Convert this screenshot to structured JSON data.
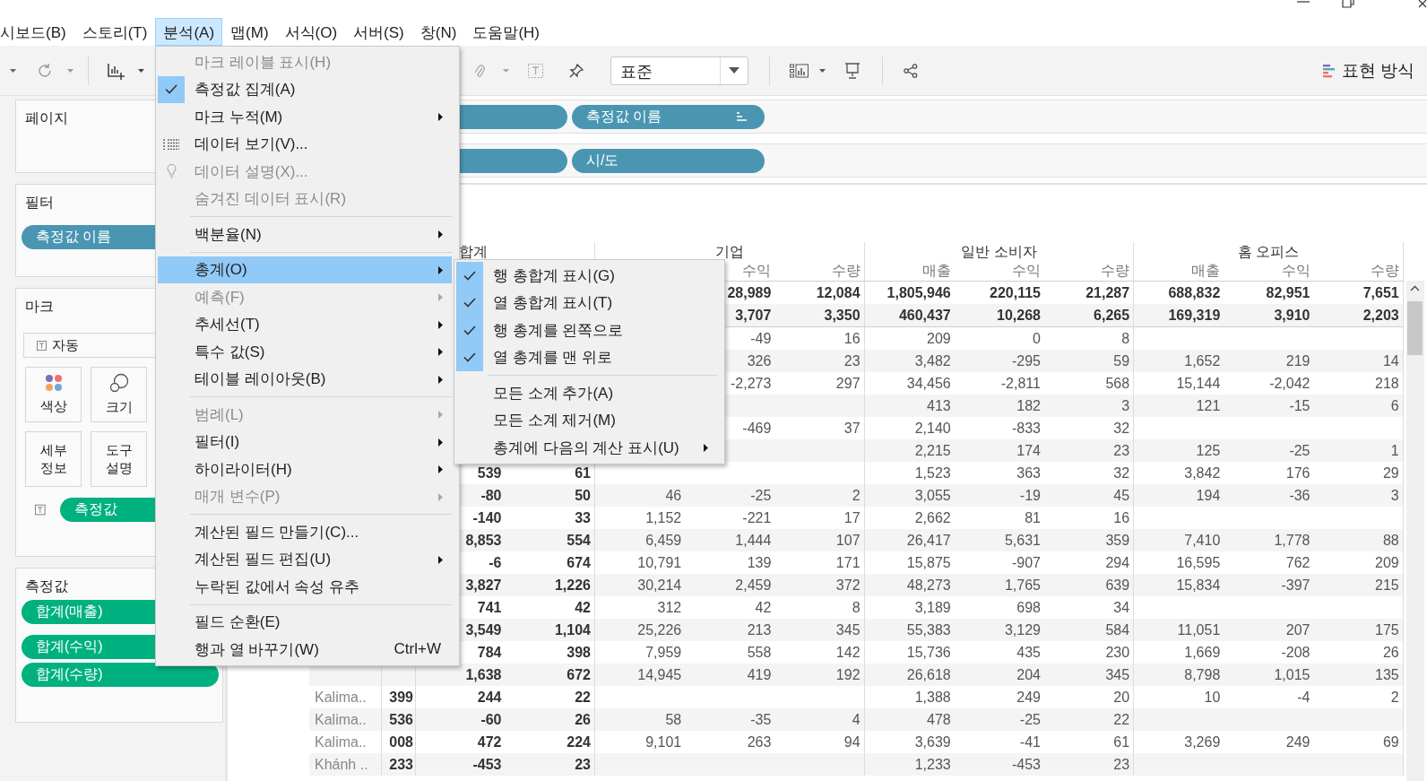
{
  "menu_bar": [
    {
      "label": "시보드(B)",
      "selected": false
    },
    {
      "label": "스토리(T)",
      "selected": false
    },
    {
      "label": "분석(A)",
      "selected": true
    },
    {
      "label": "맵(M)",
      "selected": false
    },
    {
      "label": "서식(O)",
      "selected": false
    },
    {
      "label": "서버(S)",
      "selected": false
    },
    {
      "label": "창(N)",
      "selected": false
    },
    {
      "label": "도움말(H)",
      "selected": false
    }
  ],
  "toolbar": {
    "mark_type": "표준",
    "show_me": "표현 방식"
  },
  "side_panel": {
    "pages": {
      "title": "페이지"
    },
    "filters": {
      "title": "필터",
      "pills": [
        "측정값 이름"
      ]
    },
    "marks": {
      "title": "마크",
      "mark_type": "자동",
      "buttons": [
        {
          "label": "색상",
          "kind": "color"
        },
        {
          "label": "크기",
          "kind": "size"
        },
        {
          "label": "세부 정보",
          "kind": "detail"
        },
        {
          "label": "도구 설명",
          "kind": "tooltip"
        }
      ],
      "text_pills": [
        "측정값"
      ]
    },
    "measures": {
      "title": "측정값",
      "pills": [
        "합계(매출)",
        "합계(수익)",
        "합계(수량)"
      ]
    }
  },
  "shelves": [
    {
      "pill": "측정값 이름",
      "sorted": true
    },
    {
      "pill": "시/도",
      "sorted": false
    }
  ],
  "table": {
    "groups": [
      {
        "label": "합계",
        "kind": "total",
        "columns": [
          null,
          null
        ]
      },
      {
        "label": "기업",
        "kind": "segment",
        "columns": [
          null,
          "수익",
          "수량"
        ]
      },
      {
        "label": "일반 소비자",
        "kind": "segment",
        "columns": [
          "매출",
          "수익",
          "수량"
        ]
      },
      {
        "label": "홈 오피스",
        "kind": "segment",
        "columns": [
          "매출",
          "수익",
          "수량"
        ]
      }
    ],
    "rows": [
      {
        "kind": "total",
        "header": null,
        "code": null,
        "cells": [
          null,
          null,
          null,
          "28,989",
          "12,084",
          "1,805,946",
          "220,115",
          "21,287",
          "688,832",
          "82,951",
          "7,651"
        ]
      },
      {
        "kind": "total",
        "header": null,
        "code": null,
        "cells": [
          null,
          null,
          null,
          "3,707",
          "3,350",
          "460,437",
          "10,268",
          "6,265",
          "169,319",
          "3,910",
          "2,203"
        ]
      },
      {
        "kind": "data",
        "header": null,
        "code": null,
        "cells": [
          null,
          null,
          null,
          "-49",
          "16",
          "209",
          "0",
          "8",
          null,
          null,
          null
        ]
      },
      {
        "kind": "data",
        "header": null,
        "code": null,
        "cells": [
          null,
          null,
          null,
          "326",
          "23",
          "3,482",
          "-295",
          "59",
          "1,652",
          "219",
          "14"
        ]
      },
      {
        "kind": "data",
        "header": null,
        "code": null,
        "cells": [
          null,
          null,
          null,
          "-2,273",
          "297",
          "34,456",
          "-2,811",
          "568",
          "15,144",
          "-2,042",
          "218"
        ]
      },
      {
        "kind": "data",
        "header": null,
        "code": null,
        "cells": [
          null,
          null,
          null,
          null,
          null,
          "413",
          "182",
          "3",
          "121",
          "-15",
          "6"
        ]
      },
      {
        "kind": "data",
        "header": null,
        "code": null,
        "cells": [
          null,
          null,
          null,
          "-469",
          "37",
          "2,140",
          "-833",
          "32",
          null,
          null,
          null
        ]
      },
      {
        "kind": "data",
        "header": null,
        "code": null,
        "cells": [
          null,
          null,
          null,
          null,
          null,
          "2,215",
          "174",
          "23",
          "125",
          "-25",
          "1"
        ]
      },
      {
        "kind": "data",
        "header": null,
        "code": null,
        "cells": [
          "539",
          "61",
          null,
          null,
          null,
          "1,523",
          "363",
          "32",
          "3,842",
          "176",
          "29"
        ]
      },
      {
        "kind": "data",
        "header": null,
        "code": null,
        "cells": [
          "-80",
          "50",
          "46",
          "-25",
          "2",
          "3,055",
          "-19",
          "45",
          "194",
          "-36",
          "3"
        ]
      },
      {
        "kind": "data",
        "header": null,
        "code": null,
        "cells": [
          "-140",
          "33",
          "1,152",
          "-221",
          "17",
          "2,662",
          "81",
          "16",
          null,
          null,
          null
        ]
      },
      {
        "kind": "data",
        "header": null,
        "code": null,
        "cells": [
          "8,853",
          "554",
          "6,459",
          "1,444",
          "107",
          "26,417",
          "5,631",
          "359",
          "7,410",
          "1,778",
          "88"
        ]
      },
      {
        "kind": "data",
        "header": null,
        "code": null,
        "cells": [
          "-6",
          "674",
          "10,791",
          "139",
          "171",
          "15,875",
          "-907",
          "294",
          "16,595",
          "762",
          "209"
        ]
      },
      {
        "kind": "data",
        "header": null,
        "code": null,
        "cells": [
          "3,827",
          "1,226",
          "30,214",
          "2,459",
          "372",
          "48,273",
          "1,765",
          "639",
          "15,834",
          "-397",
          "215"
        ]
      },
      {
        "kind": "data",
        "header": null,
        "code": null,
        "cells": [
          "741",
          "42",
          "312",
          "42",
          "8",
          "3,189",
          "698",
          "34",
          null,
          null,
          null
        ]
      },
      {
        "kind": "data",
        "header": null,
        "code": null,
        "cells": [
          "3,549",
          "1,104",
          "25,226",
          "213",
          "345",
          "55,383",
          "3,129",
          "584",
          "11,051",
          "207",
          "175"
        ]
      },
      {
        "kind": "data",
        "header": null,
        "code": null,
        "cells": [
          "784",
          "398",
          "7,959",
          "558",
          "142",
          "15,736",
          "435",
          "230",
          "1,669",
          "-208",
          "26"
        ]
      },
      {
        "kind": "data",
        "header": null,
        "code": null,
        "cells": [
          "1,638",
          "672",
          "14,945",
          "419",
          "192",
          "26,618",
          "204",
          "345",
          "8,798",
          "1,015",
          "135"
        ]
      },
      {
        "kind": "data",
        "header": "Kalima..",
        "code": "399",
        "cells": [
          "244",
          "22",
          null,
          null,
          null,
          "1,388",
          "249",
          "20",
          "10",
          "-4",
          "2"
        ]
      },
      {
        "kind": "data",
        "header": "Kalima..",
        "code": "536",
        "cells": [
          "-60",
          "26",
          "58",
          "-35",
          "4",
          "478",
          "-25",
          "22",
          null,
          null,
          null
        ]
      },
      {
        "kind": "data",
        "header": "Kalima..",
        "code": "008",
        "cells": [
          "472",
          "224",
          "9,101",
          "263",
          "94",
          "3,639",
          "-41",
          "61",
          "3,269",
          "249",
          "69"
        ]
      },
      {
        "kind": "data",
        "header": "Khánh ..",
        "code": "233",
        "cells": [
          "-453",
          "23",
          null,
          null,
          null,
          "1,233",
          "-453",
          "23",
          null,
          null,
          null
        ]
      }
    ]
  },
  "analysis_menu": {
    "items": [
      {
        "kind": "plain",
        "label": "마크 레이블 표시(H)",
        "disabled": true,
        "checked": false,
        "selected": false,
        "submenu": false
      },
      {
        "kind": "plain",
        "label": "측정값 집계(A)",
        "disabled": false,
        "checked": true,
        "selected": false,
        "submenu": false
      },
      {
        "kind": "plain",
        "label": "마크 누적(M)",
        "disabled": false,
        "checked": false,
        "selected": false,
        "submenu": true
      },
      {
        "kind": "data-grid",
        "label": "데이터 보기(V)...",
        "disabled": false,
        "checked": false,
        "selected": false,
        "submenu": false
      },
      {
        "kind": "bulb",
        "label": "데이터 설명(X)...",
        "disabled": true,
        "checked": false,
        "selected": false,
        "submenu": false
      },
      {
        "kind": "plain",
        "label": "숨겨진 데이터 표시(R)",
        "disabled": true,
        "checked": false,
        "selected": false,
        "submenu": false
      },
      {
        "kind": "separator"
      },
      {
        "kind": "plain",
        "label": "백분율(N)",
        "disabled": false,
        "checked": false,
        "selected": false,
        "submenu": true
      },
      {
        "kind": "separator"
      },
      {
        "kind": "plain",
        "label": "총계(O)",
        "disabled": false,
        "checked": false,
        "selected": true,
        "submenu": true
      },
      {
        "kind": "plain",
        "label": "예측(F)",
        "disabled": true,
        "checked": false,
        "selected": false,
        "submenu": true
      },
      {
        "kind": "plain",
        "label": "추세선(T)",
        "disabled": false,
        "checked": false,
        "selected": false,
        "submenu": true
      },
      {
        "kind": "plain",
        "label": "특수 값(S)",
        "disabled": false,
        "checked": false,
        "selected": false,
        "submenu": true
      },
      {
        "kind": "plain",
        "label": "테이블 레이아웃(B)",
        "disabled": false,
        "checked": false,
        "selected": false,
        "submenu": true
      },
      {
        "kind": "separator"
      },
      {
        "kind": "plain",
        "label": "범례(L)",
        "disabled": true,
        "checked": false,
        "selected": false,
        "submenu": true
      },
      {
        "kind": "plain",
        "label": "필터(I)",
        "disabled": false,
        "checked": false,
        "selected": false,
        "submenu": true
      },
      {
        "kind": "plain",
        "label": "하이라이터(H)",
        "disabled": false,
        "checked": false,
        "selected": false,
        "submenu": true
      },
      {
        "kind": "plain",
        "label": "매개 변수(P)",
        "disabled": true,
        "checked": false,
        "selected": false,
        "submenu": true
      },
      {
        "kind": "separator"
      },
      {
        "kind": "plain",
        "label": "계산된 필드 만들기(C)...",
        "disabled": false,
        "checked": false,
        "selected": false,
        "submenu": false
      },
      {
        "kind": "plain",
        "label": "계산된 필드 편집(U)",
        "disabled": false,
        "checked": false,
        "selected": false,
        "submenu": true
      },
      {
        "kind": "plain",
        "label": "누락된 값에서 속성 유추",
        "disabled": false,
        "checked": false,
        "selected": false,
        "submenu": false
      },
      {
        "kind": "separator"
      },
      {
        "kind": "plain",
        "label": "필드 순환(E)",
        "disabled": false,
        "checked": false,
        "selected": false,
        "submenu": false
      },
      {
        "kind": "plain",
        "label": "행과 열 바꾸기(W)",
        "shortcut": "Ctrl+W",
        "disabled": false,
        "checked": false,
        "selected": false,
        "submenu": false
      }
    ]
  },
  "totals_submenu": {
    "items": [
      {
        "kind": "plain",
        "label": "행 총합계 표시(G)",
        "checked": true,
        "submenu": false
      },
      {
        "kind": "plain",
        "label": "열 총합계 표시(T)",
        "checked": true,
        "submenu": false
      },
      {
        "kind": "plain",
        "label": "행 총계를 왼쪽으로",
        "checked": true,
        "submenu": false
      },
      {
        "kind": "plain",
        "label": "열 총계를 맨 위로",
        "checked": true,
        "submenu": false
      },
      {
        "kind": "separator"
      },
      {
        "kind": "plain",
        "label": "모든 소계 추가(A)",
        "checked": false,
        "submenu": false
      },
      {
        "kind": "plain",
        "label": "모든 소계 제거(M)",
        "checked": false,
        "submenu": false
      },
      {
        "kind": "plain",
        "label": "총계에 다음의 계산 표시(U)",
        "checked": false,
        "submenu": true
      }
    ]
  }
}
